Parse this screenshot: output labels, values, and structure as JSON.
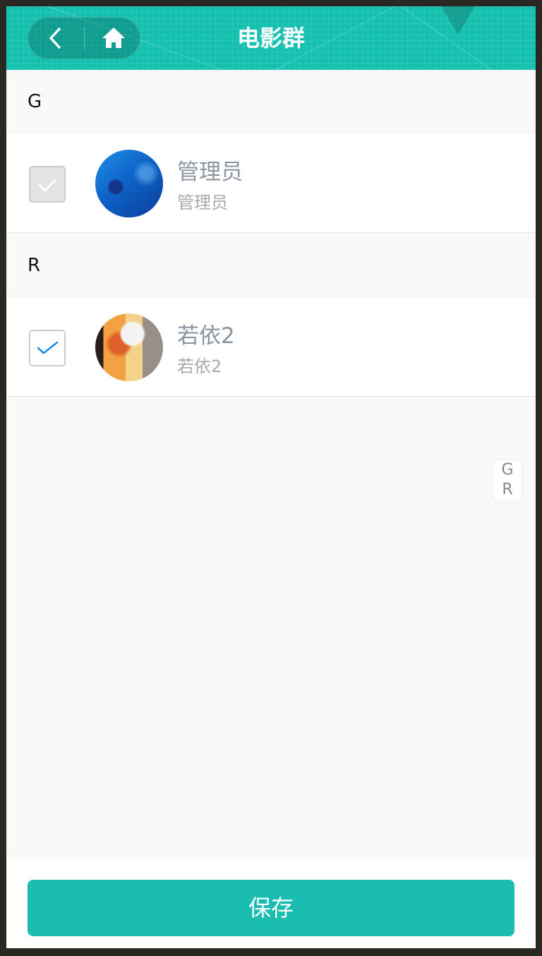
{
  "header": {
    "title": "电影群",
    "back_icon": "chevron-left-icon",
    "home_icon": "home-icon"
  },
  "sections": [
    {
      "letter": "G",
      "members": [
        {
          "name": "管理员",
          "sub": "管理员",
          "checked": true,
          "disabled": true
        }
      ]
    },
    {
      "letter": "R",
      "members": [
        {
          "name": "若依2",
          "sub": "若依2",
          "checked": true,
          "disabled": false
        }
      ]
    }
  ],
  "index_bar": [
    "G",
    "R"
  ],
  "footer": {
    "save_label": "保存"
  },
  "colors": {
    "accent": "#1bbdb1",
    "header_bg": "#15c0b0",
    "check_active": "#1a8ae6"
  }
}
